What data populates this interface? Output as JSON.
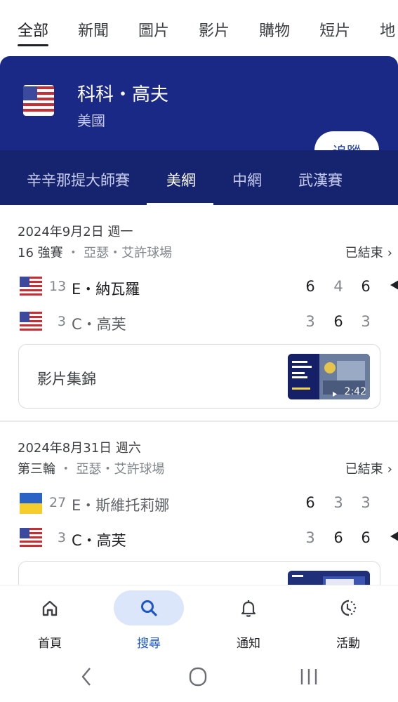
{
  "filter_tabs": [
    "全部",
    "新聞",
    "圖片",
    "影片",
    "購物",
    "短片",
    "地"
  ],
  "player": {
    "name": "科科・高夫",
    "country": "美國",
    "follow_label": "追蹤"
  },
  "tournament_tabs": [
    "辛辛那提大師賽",
    "美網",
    "中網",
    "武漢賽"
  ],
  "matches": [
    {
      "date": "2024年9月2日 週一",
      "round": "16 強賽",
      "venue": "・ 亞瑟・艾許球場",
      "status": "已結束",
      "players": [
        {
          "seed": "13",
          "name": "E・納瓦羅",
          "flag": "usa",
          "scores": [
            "6",
            "4",
            "6"
          ]
        },
        {
          "seed": "3",
          "name": "C・高芙",
          "flag": "usa",
          "scores": [
            "3",
            "6",
            "3"
          ]
        }
      ],
      "highlights": {
        "label": "影片集錦",
        "duration": "2:42"
      }
    },
    {
      "date": "2024年8月31日 週六",
      "round": "第三輪",
      "venue": "・ 亞瑟・艾許球場",
      "status": "已結束",
      "players": [
        {
          "seed": "27",
          "name": "E・斯維托莉娜",
          "flag": "ukraine",
          "scores": [
            "6",
            "3",
            "3"
          ]
        },
        {
          "seed": "3",
          "name": "C・高芙",
          "flag": "usa",
          "scores": [
            "3",
            "6",
            "6"
          ]
        }
      ],
      "highlights": {
        "label": "",
        "duration": ""
      }
    }
  ],
  "bottom_nav": [
    "首頁",
    "搜尋",
    "通知",
    "活動"
  ],
  "colors": {
    "header_bg": "#1b2986",
    "tabs_bg": "#16246f",
    "accent": "#1a56c8",
    "active_pill": "#dce6fb"
  }
}
